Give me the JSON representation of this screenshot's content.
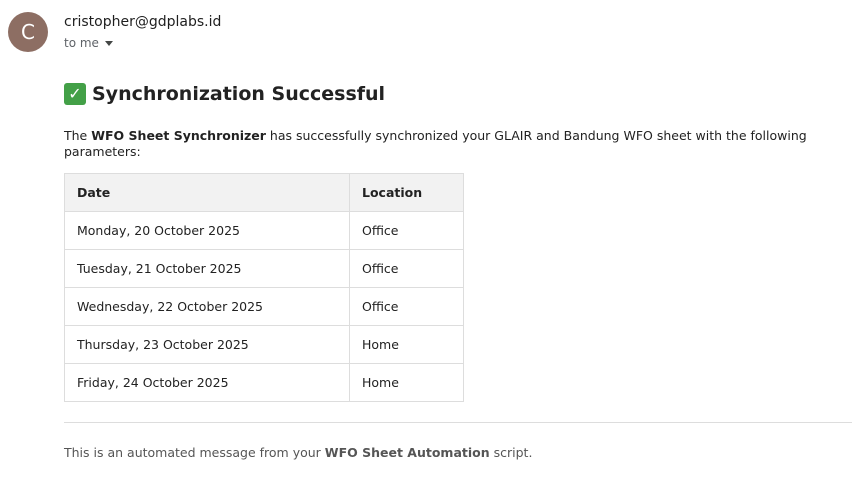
{
  "sender": {
    "avatar_letter": "C",
    "avatar_color": "#8d6e63",
    "email": "cristopher@gdplabs.id",
    "recipient_label": "to me"
  },
  "message": {
    "heading": "Synchronization Successful",
    "heading_icon": "check-mark-button-icon",
    "intro_prefix": "The ",
    "intro_bold": "WFO Sheet Synchronizer",
    "intro_suffix": " has successfully synchronized your GLAIR and Bandung WFO sheet with the following parameters:",
    "table": {
      "headers": [
        "Date",
        "Location"
      ],
      "rows": [
        [
          "Monday, 20 October 2025",
          "Office"
        ],
        [
          "Tuesday, 21 October 2025",
          "Office"
        ],
        [
          "Wednesday, 22 October 2025",
          "Office"
        ],
        [
          "Thursday, 23 October 2025",
          "Home"
        ],
        [
          "Friday, 24 October 2025",
          "Home"
        ]
      ]
    },
    "footer_prefix": "This is an automated message from your ",
    "footer_bold": "WFO Sheet Automation",
    "footer_suffix": " script."
  }
}
